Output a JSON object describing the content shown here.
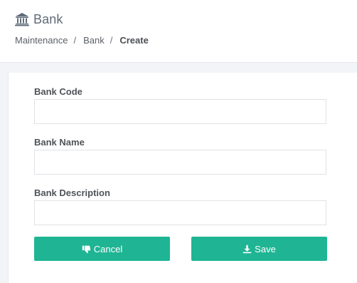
{
  "header": {
    "title": "Bank",
    "icon": "bank-building-icon"
  },
  "breadcrumb": {
    "items": [
      "Maintenance",
      "Bank",
      "Create"
    ],
    "separator": "/"
  },
  "form": {
    "bank_code": {
      "label": "Bank Code",
      "value": "",
      "placeholder": ""
    },
    "bank_name": {
      "label": "Bank Name",
      "value": "",
      "placeholder": ""
    },
    "bank_description": {
      "label": "Bank Description",
      "value": "",
      "placeholder": ""
    },
    "cancel": {
      "label": "Cancel",
      "icon": "thumbs-down-icon"
    },
    "save": {
      "label": "Save",
      "icon": "download-icon"
    }
  },
  "colors": {
    "accent": "#1fb594",
    "icon": "#5f6b78"
  }
}
